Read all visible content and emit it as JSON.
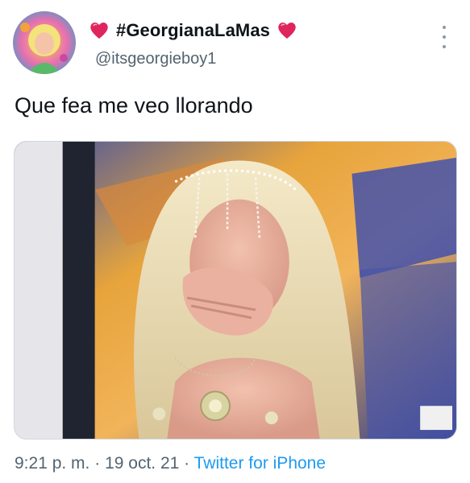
{
  "tweet": {
    "display_name": "#GeorgianaLaMas",
    "handle": "@itsgeorgieboy1",
    "text": "Que fea me veo llorando",
    "time": "9:21 p. m.",
    "separator": "·",
    "date": "19 oct. 21",
    "source": "Twitter for iPhone",
    "name_emoji": "red-heart-emoji"
  },
  "colors": {
    "text": "#0f1419",
    "muted": "#536471",
    "link": "#1d9bf0",
    "heart": "#e0245e"
  }
}
